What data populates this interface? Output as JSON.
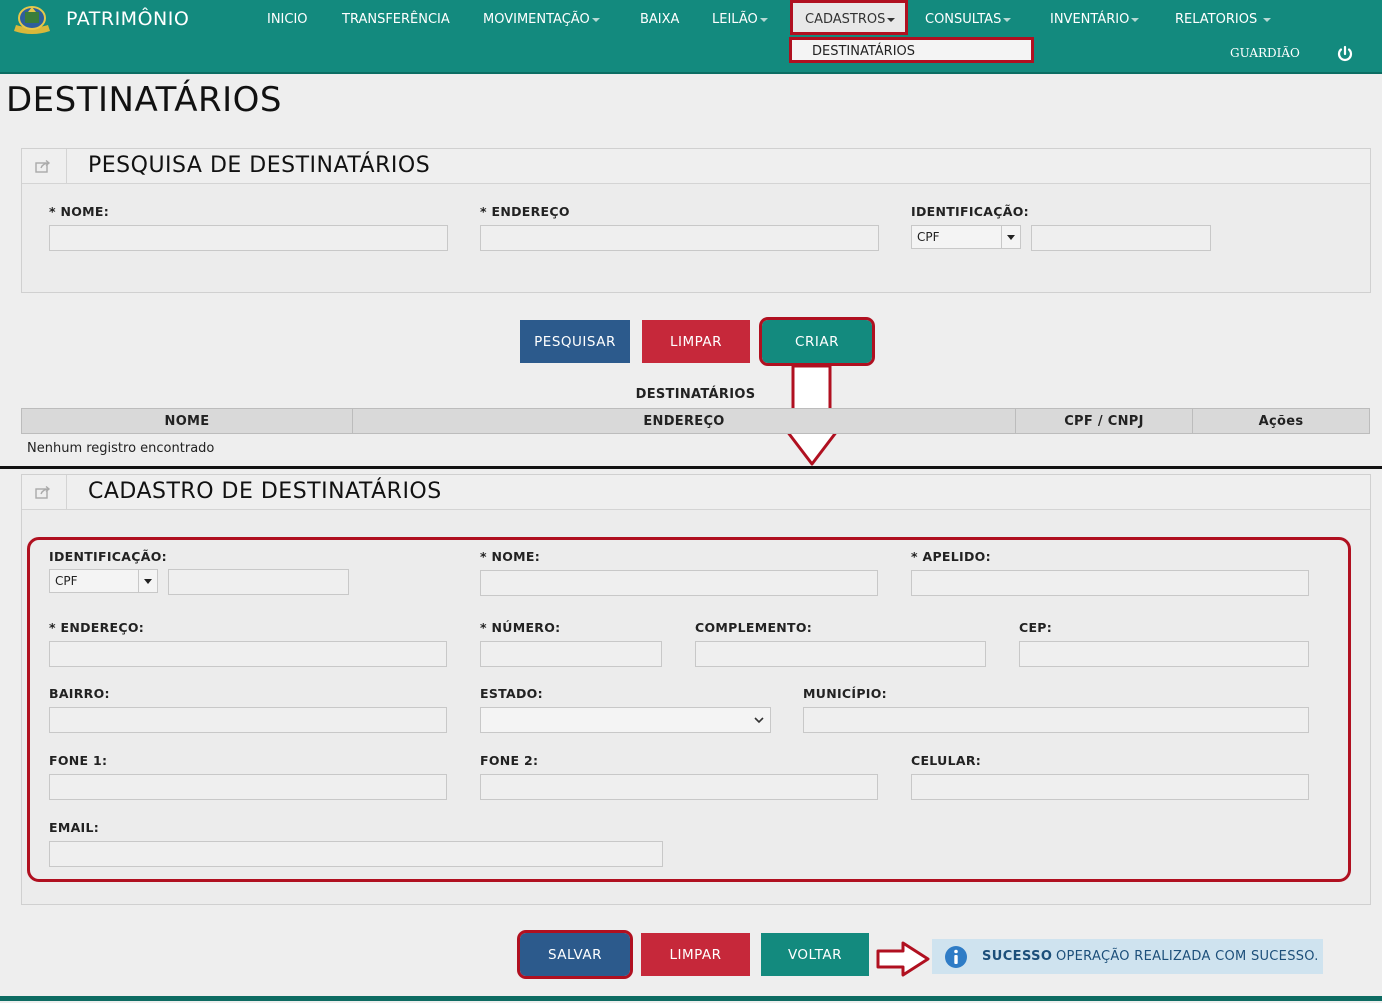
{
  "app": {
    "title": "PATRIMÔNIO"
  },
  "nav": {
    "items": [
      {
        "label": "INICIO",
        "has_caret": false
      },
      {
        "label": "TRANSFERÊNCIA",
        "has_caret": false
      },
      {
        "label": "MOVIMENTAÇÃO",
        "has_caret": true
      },
      {
        "label": "BAIXA",
        "has_caret": false
      },
      {
        "label": "LEILÃO",
        "has_caret": true
      },
      {
        "label": "CADASTROS",
        "has_caret": true,
        "active": true
      },
      {
        "label": "CONSULTAS",
        "has_caret": true
      },
      {
        "label": "INVENTÁRIO",
        "has_caret": true
      },
      {
        "label": "RELATORIOS",
        "has_caret": true
      }
    ],
    "dropdown_item": "DESTINATÁRIOS",
    "user": "GUARDIÃO",
    "logout_icon": "power-icon"
  },
  "page": {
    "title": "DESTINATÁRIOS"
  },
  "search_panel": {
    "title": "PESQUISA DE DESTINATÁRIOS",
    "icon": "share-icon",
    "fields": {
      "nome": {
        "label": "* NOME:",
        "value": ""
      },
      "endereco": {
        "label": "* ENDEREÇO",
        "value": ""
      },
      "identificacao": {
        "label": "IDENTIFICAÇÃO:",
        "type_value": "CPF",
        "value": ""
      }
    },
    "buttons": {
      "pesquisar": "PESQUISAR",
      "limpar": "LIMPAR",
      "criar": "CRIAR"
    }
  },
  "results": {
    "caption": "DESTINATÁRIOS",
    "columns": [
      "NOME",
      "ENDEREÇO",
      "CPF / CNPJ",
      "Ações"
    ],
    "empty_message": "Nenhum registro encontrado"
  },
  "form_panel": {
    "title": "CADASTRO DE DESTINATÁRIOS",
    "icon": "share-icon",
    "fields": {
      "identificacao": {
        "label": "IDENTIFICAÇÃO:",
        "type_value": "CPF",
        "value": ""
      },
      "nome": {
        "label": "* NOME:",
        "value": ""
      },
      "apelido": {
        "label": "* APELIDO:",
        "value": ""
      },
      "endereco": {
        "label": "* ENDEREÇO:",
        "value": ""
      },
      "numero": {
        "label": "* NÚMERO:",
        "value": ""
      },
      "complemento": {
        "label": "COMPLEMENTO:",
        "value": ""
      },
      "cep": {
        "label": "CEP:",
        "value": ""
      },
      "bairro": {
        "label": "BAIRRO:",
        "value": ""
      },
      "estado": {
        "label": "ESTADO:",
        "value": ""
      },
      "municipio": {
        "label": "MUNICÍPIO:",
        "value": ""
      },
      "fone1": {
        "label": "FONE 1:",
        "value": ""
      },
      "fone2": {
        "label": "FONE 2:",
        "value": ""
      },
      "celular": {
        "label": "CELULAR:",
        "value": ""
      },
      "email": {
        "label": "EMAIL:",
        "value": ""
      }
    },
    "buttons": {
      "salvar": "SALVAR",
      "limpar": "LIMPAR",
      "voltar": "VOLTAR"
    }
  },
  "message": {
    "icon": "info-icon",
    "title": "SUCESSO",
    "text": "OPERAÇÃO REALIZADA COM SUCESSO."
  },
  "colors": {
    "primary_teal": "#138a7e",
    "blue_button": "#2c5a8c",
    "red_button": "#c6283a",
    "highlight_red": "#b01020",
    "info_bg": "#cfe3ef"
  }
}
